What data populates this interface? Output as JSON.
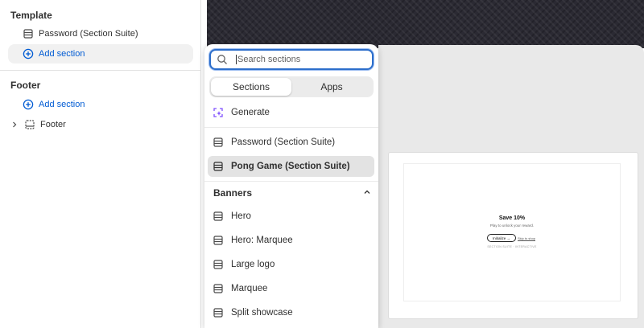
{
  "sidebar": {
    "template_title": "Template",
    "template_items": [
      {
        "label": "Password (Section Suite)",
        "icon": "section-icon"
      }
    ],
    "template_add": "Add section",
    "footer_title": "Footer",
    "footer_add": "Add section",
    "footer_items": [
      {
        "label": "Footer",
        "icon": "section-icon"
      }
    ]
  },
  "picker": {
    "search_placeholder": "Search sections",
    "tabs": [
      "Sections",
      "Apps"
    ],
    "generate_label": "Generate",
    "recent": [
      {
        "label": "Password (Section Suite)"
      },
      {
        "label": "Pong Game (Section Suite)",
        "selected": true
      }
    ],
    "banners_title": "Banners",
    "banners": [
      {
        "label": "Hero"
      },
      {
        "label": "Hero: Marquee"
      },
      {
        "label": "Large logo"
      },
      {
        "label": "Marquee"
      },
      {
        "label": "Split showcase"
      }
    ]
  },
  "preview": {
    "title": "Save 10%",
    "subtitle": "Play to unlock your reward.",
    "button": "Initialize →",
    "link": "Skip to shop",
    "footer": "SECTION SUITE · INTERACTIVE"
  },
  "colors": {
    "accent": "#005bd3",
    "focus": "#2c6ecb",
    "generate": "#8051ff"
  }
}
